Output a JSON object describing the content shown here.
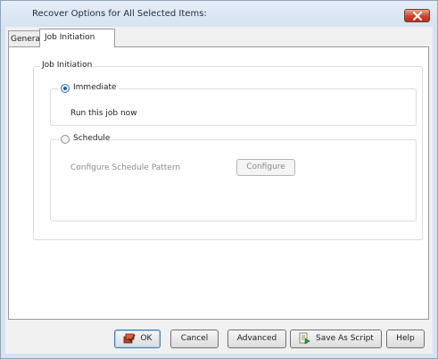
{
  "window": {
    "title": "Recover Options for All Selected Items:"
  },
  "tabs": [
    {
      "label": "General",
      "active": false
    },
    {
      "label": "Job Initiation",
      "active": true
    }
  ],
  "job_initiation": {
    "group_title": "Job Initiation",
    "immediate": {
      "label": "Immediate",
      "checked": true,
      "description": "Run this job now"
    },
    "schedule": {
      "label": "Schedule",
      "checked": false,
      "pattern_label": "Configure Schedule Pattern",
      "configure_button": "Configure"
    }
  },
  "buttons": {
    "ok": "OK",
    "cancel": "Cancel",
    "advanced": "Advanced",
    "save_as_script": "Save As Script",
    "help": "Help"
  },
  "colors": {
    "title_bar": "#d6e2f0",
    "close_button": "#c8472f",
    "accent": "#2a5ea8"
  }
}
